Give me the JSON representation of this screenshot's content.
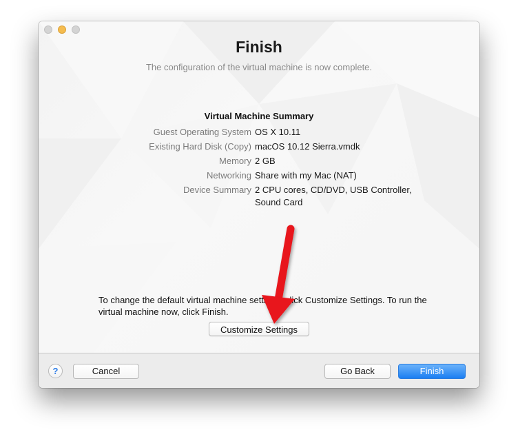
{
  "window": {
    "title": "Finish",
    "subtitle": "The configuration of the virtual machine is now complete."
  },
  "summary": {
    "heading": "Virtual Machine Summary",
    "rows": [
      {
        "label": "Guest Operating System",
        "value": "OS X 10.11"
      },
      {
        "label": "Existing Hard Disk (Copy)",
        "value": "macOS 10.12 Sierra.vmdk"
      },
      {
        "label": "Memory",
        "value": "2 GB"
      },
      {
        "label": "Networking",
        "value": "Share with my Mac (NAT)"
      },
      {
        "label": "Device Summary",
        "value": "2 CPU cores, CD/DVD, USB Controller, Sound Card"
      }
    ]
  },
  "instruction": "To change the default virtual machine settings, click Customize Settings. To run the virtual machine now, click Finish.",
  "buttons": {
    "customize": "Customize Settings",
    "help": "?",
    "cancel": "Cancel",
    "go_back": "Go Back",
    "finish": "Finish"
  },
  "icons": {
    "help": "help-icon",
    "close": "close-window-icon",
    "minimize": "minimize-window-icon",
    "zoom": "zoom-window-icon",
    "arrow": "red-arrow-annotation-icon"
  },
  "colors": {
    "accent": "#1b7ef2",
    "arrow": "#e8121b",
    "minimize": "#f5bc4f"
  }
}
